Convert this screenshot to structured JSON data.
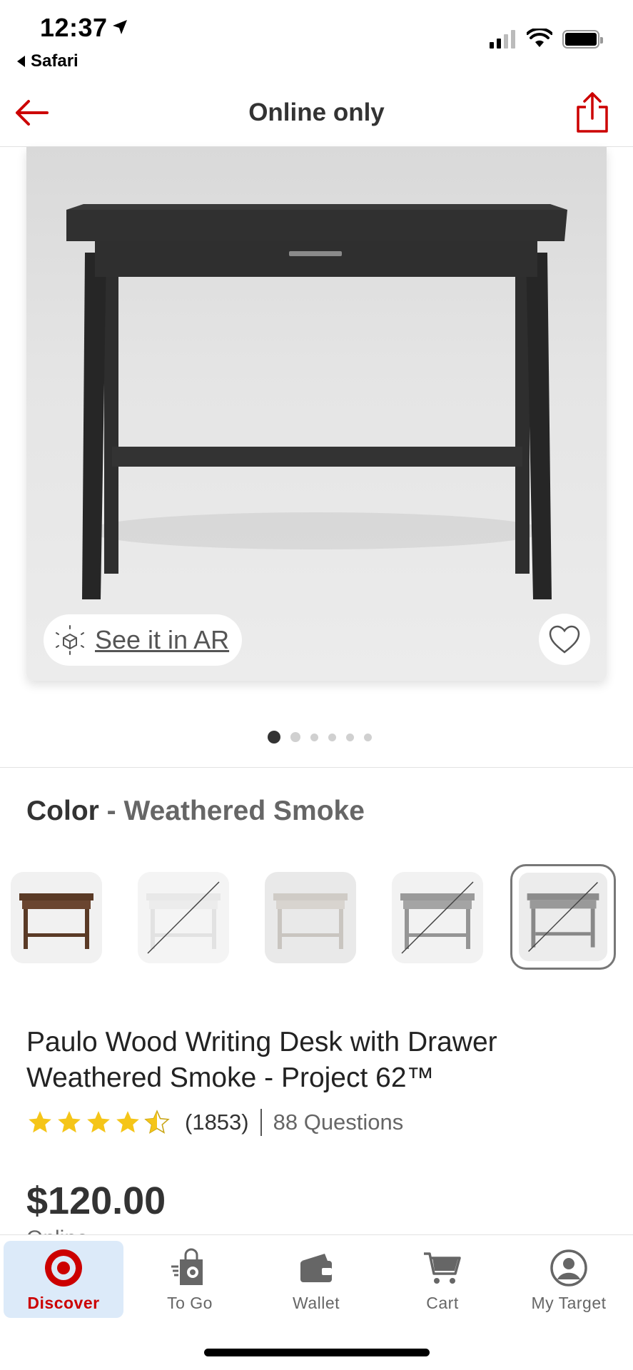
{
  "status_bar": {
    "time": "12:37",
    "back_app": "Safari"
  },
  "header": {
    "title": "Online only"
  },
  "product_image": {
    "ar_label": "See it in AR",
    "dots_count": 6,
    "active_dot": 0
  },
  "color": {
    "label": "Color",
    "separator": " - ",
    "value": "Weathered Smoke",
    "swatches": [
      {
        "name": "brown",
        "available": true,
        "selected": false
      },
      {
        "name": "white",
        "available": false,
        "selected": false
      },
      {
        "name": "light-gray",
        "available": true,
        "selected": false
      },
      {
        "name": "gray",
        "available": false,
        "selected": false
      },
      {
        "name": "weathered-smoke",
        "available": false,
        "selected": true
      }
    ]
  },
  "product": {
    "title_line1": "Paulo Wood Writing Desk with Drawer",
    "title_line2": "Weathered Smoke - Project 62™",
    "rating": 4.5,
    "review_count": "(1853)",
    "questions": "88 Questions",
    "price": "$120.00",
    "availability": "Online"
  },
  "tabs": [
    {
      "label": "Discover",
      "icon": "target-logo-icon",
      "active": true
    },
    {
      "label": "To Go",
      "icon": "to-go-bag-icon",
      "active": false
    },
    {
      "label": "Wallet",
      "icon": "wallet-icon",
      "active": false
    },
    {
      "label": "Cart",
      "icon": "cart-icon",
      "active": false
    },
    {
      "label": "My Target",
      "icon": "profile-icon",
      "active": false
    }
  ],
  "colors": {
    "accent_red": "#cc0000",
    "active_tab_bg": "#dceaf9",
    "star_yellow": "#f5c518"
  }
}
